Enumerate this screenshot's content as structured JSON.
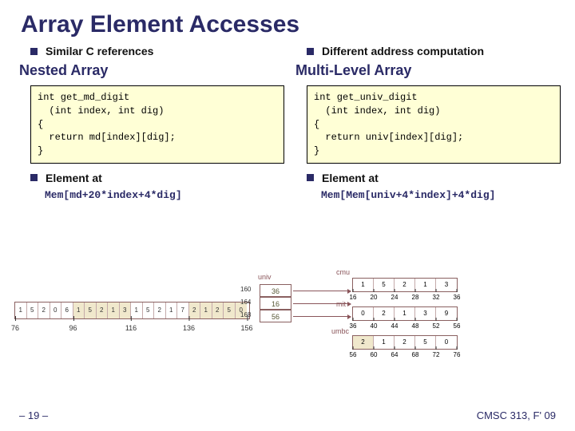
{
  "title": "Array Element Accesses",
  "left": {
    "bullet": "Similar C references",
    "subhead": "Nested Array",
    "code": "int get_md_digit\n  (int index, int dig)\n{\n  return md[index][dig];\n}",
    "elem_label": "Element at",
    "elem_expr": "Mem[md+20*index+4*dig]"
  },
  "right": {
    "bullet": "Different address computation",
    "subhead": "Multi-Level Array",
    "code": "int get_univ_digit\n  (int index, int dig)\n{\n  return univ[index][dig];\n}",
    "elem_label": "Element at",
    "elem_expr": "Mem[Mem[univ+4*index]+4*dig]"
  },
  "nested_band": {
    "cells": [
      "1",
      "5",
      "2",
      "0",
      "6",
      "1",
      "5",
      "2",
      "1",
      "3",
      "1",
      "5",
      "2",
      "1",
      "7",
      "2",
      "1",
      "2",
      "5",
      "0"
    ],
    "ticks": [
      "76",
      "96",
      "116",
      "136",
      "156"
    ]
  },
  "univ_label": "univ",
  "univ_cells": [
    "36",
    "16",
    "56"
  ],
  "univ_ticks": [
    "160",
    "164",
    "168"
  ],
  "bands": {
    "cmu": {
      "label": "cmu",
      "cells": [
        "1",
        "5",
        "2",
        "1",
        "3"
      ],
      "ticks": [
        "16",
        "20",
        "24",
        "28",
        "32",
        "36"
      ]
    },
    "mit": {
      "label": "mit",
      "cells": [
        "0",
        "2",
        "1",
        "3",
        "9"
      ],
      "ticks": [
        "36",
        "40",
        "44",
        "48",
        "52",
        "56"
      ]
    },
    "umbc": {
      "label": "umbc",
      "cells": [
        "1",
        "2",
        "5",
        "0"
      ],
      "ticks": [
        "56",
        "60",
        "64",
        "68",
        "72",
        "76"
      ],
      "shadeLast": true,
      "pad": "2"
    }
  },
  "footer": {
    "left": "– 19 –",
    "right": "CMSC 313, F' 09"
  }
}
